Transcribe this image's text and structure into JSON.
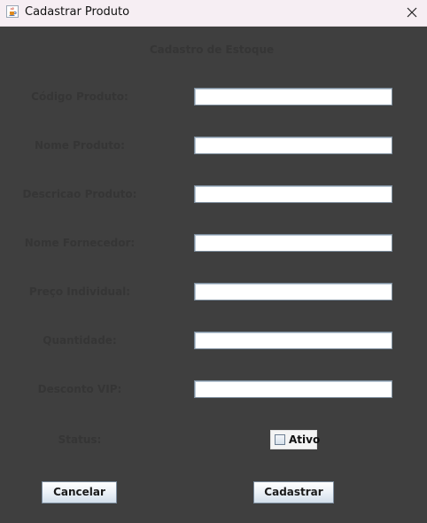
{
  "window": {
    "title": "Cadastrar Produto",
    "icon": "java-cup-icon",
    "close_icon": "close-icon"
  },
  "form": {
    "heading": "Cadastro de Estoque",
    "fields": [
      {
        "label": "Código Produto:",
        "value": ""
      },
      {
        "label": "Nome Produto:",
        "value": ""
      },
      {
        "label": "Descricao Produto:",
        "value": ""
      },
      {
        "label": "Nome Fornecedor:",
        "value": ""
      },
      {
        "label": "Preço Individual:",
        "value": ""
      },
      {
        "label": "Quantidade:",
        "value": ""
      },
      {
        "label": "Desconto VIP:",
        "value": ""
      }
    ],
    "status_label": "Status:",
    "status_checkbox_label": "Ativo",
    "status_checked": false
  },
  "buttons": {
    "cancel": "Cancelar",
    "submit": "Cadastrar"
  },
  "colors": {
    "background": "#3f3f3f",
    "label_text": "#353535",
    "titlebar": "#f6eef3"
  }
}
